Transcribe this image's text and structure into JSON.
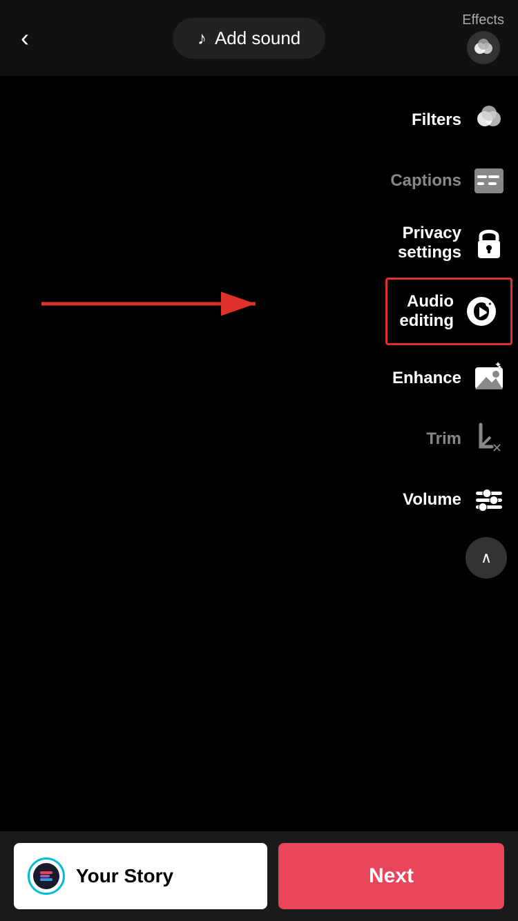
{
  "header": {
    "back_label": "‹",
    "add_sound_label": "Add sound",
    "effects_label": "Effects"
  },
  "panel": {
    "filters_label": "Filters",
    "captions_label": "Captions",
    "privacy_settings_label": "Privacy settings",
    "audio_editing_label": "Audio editing",
    "enhance_label": "Enhance",
    "trim_label": "Trim",
    "volume_label": "Volume"
  },
  "bottom": {
    "your_story_label": "Your Story",
    "next_label": "Next"
  },
  "colors": {
    "highlight_border": "#e0302a",
    "next_bg": "#e8445a",
    "muted": "#888888",
    "white": "#ffffff",
    "story_border": "#00bcd4"
  }
}
